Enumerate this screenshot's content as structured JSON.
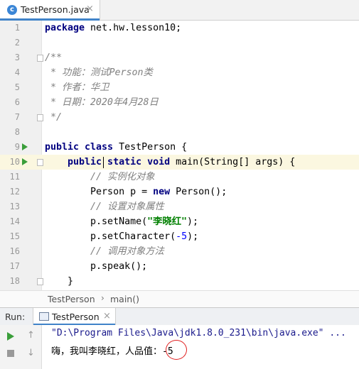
{
  "tab": {
    "label": "TestPerson.java",
    "close": "×",
    "icon_letter": "c"
  },
  "lines": [
    {
      "n": "1"
    },
    {
      "n": "2"
    },
    {
      "n": "3"
    },
    {
      "n": "4"
    },
    {
      "n": "5"
    },
    {
      "n": "6"
    },
    {
      "n": "7"
    },
    {
      "n": "8"
    },
    {
      "n": "9"
    },
    {
      "n": "10"
    },
    {
      "n": "11"
    },
    {
      "n": "12"
    },
    {
      "n": "13"
    },
    {
      "n": "14"
    },
    {
      "n": "15"
    },
    {
      "n": "16"
    },
    {
      "n": "17"
    },
    {
      "n": "18"
    }
  ],
  "code": {
    "l1_kw": "package",
    "l1_rest": " net.hw.lesson10;",
    "l3": "/**",
    "l4": " * 功能：测试Person类",
    "l5": " * 作者：华卫",
    "l6": " * 日期：2020年4月28日",
    "l7": " */",
    "l9_kw": "public class",
    "l9_rest": " TestPerson {",
    "l10_kw1": "    public static void",
    "l10_rest": " main(String[] args) {",
    "l11": "        // 实例化对象",
    "l12_a": "        Person p = ",
    "l12_kw": "new",
    "l12_b": " Person();",
    "l13": "        // 设置对象属性",
    "l14_a": "        p.setName(",
    "l14_str": "\"李晓红\"",
    "l14_b": ");",
    "l15_a": "        p.setCharacter(",
    "l15_num": "-5",
    "l15_b": ");",
    "l16": "        // 调用对象方法",
    "l17": "        p.speak();",
    "l18": "    }"
  },
  "breadcrumb": {
    "class": "TestPerson",
    "sep": "›",
    "method": "main()"
  },
  "run": {
    "label": "Run:",
    "tab_label": "TestPerson",
    "tab_close": "×"
  },
  "console": {
    "cmd": "\"D:\\Program Files\\Java\\jdk1.8.0_231\\bin\\java.exe\" ...",
    "output": "嗨，我叫李晓红，人品值：-5"
  },
  "colors": {
    "accent": "#4083c9",
    "run_green": "#3a9e3a",
    "highlight_circle": "#e02020"
  }
}
